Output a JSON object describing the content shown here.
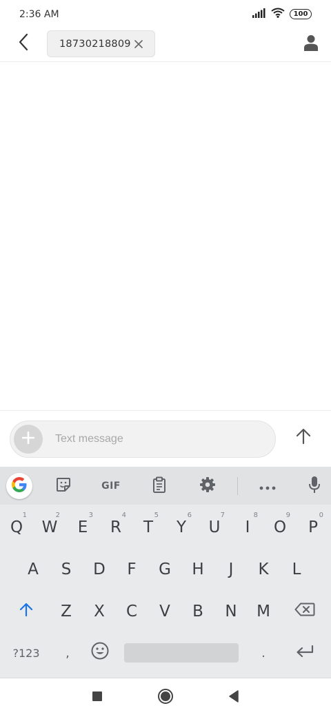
{
  "status_bar": {
    "time": "2:36 AM",
    "battery": "100"
  },
  "header": {
    "recipient": "18730218809"
  },
  "composer": {
    "placeholder": "Text message"
  },
  "keyboard": {
    "toolbar": {
      "gif_label": "GIF"
    },
    "row1": [
      {
        "label": "Q",
        "hint": "1"
      },
      {
        "label": "W",
        "hint": "2"
      },
      {
        "label": "E",
        "hint": "3"
      },
      {
        "label": "R",
        "hint": "4"
      },
      {
        "label": "T",
        "hint": "5"
      },
      {
        "label": "Y",
        "hint": "6"
      },
      {
        "label": "U",
        "hint": "7"
      },
      {
        "label": "I",
        "hint": "8"
      },
      {
        "label": "O",
        "hint": "9"
      },
      {
        "label": "P",
        "hint": "0"
      }
    ],
    "row2": [
      "A",
      "S",
      "D",
      "F",
      "G",
      "H",
      "J",
      "K",
      "L"
    ],
    "row3": [
      "Z",
      "X",
      "C",
      "V",
      "B",
      "N",
      "M"
    ],
    "row4": {
      "symbols": "?123",
      "comma": ",",
      "period": "."
    }
  }
}
